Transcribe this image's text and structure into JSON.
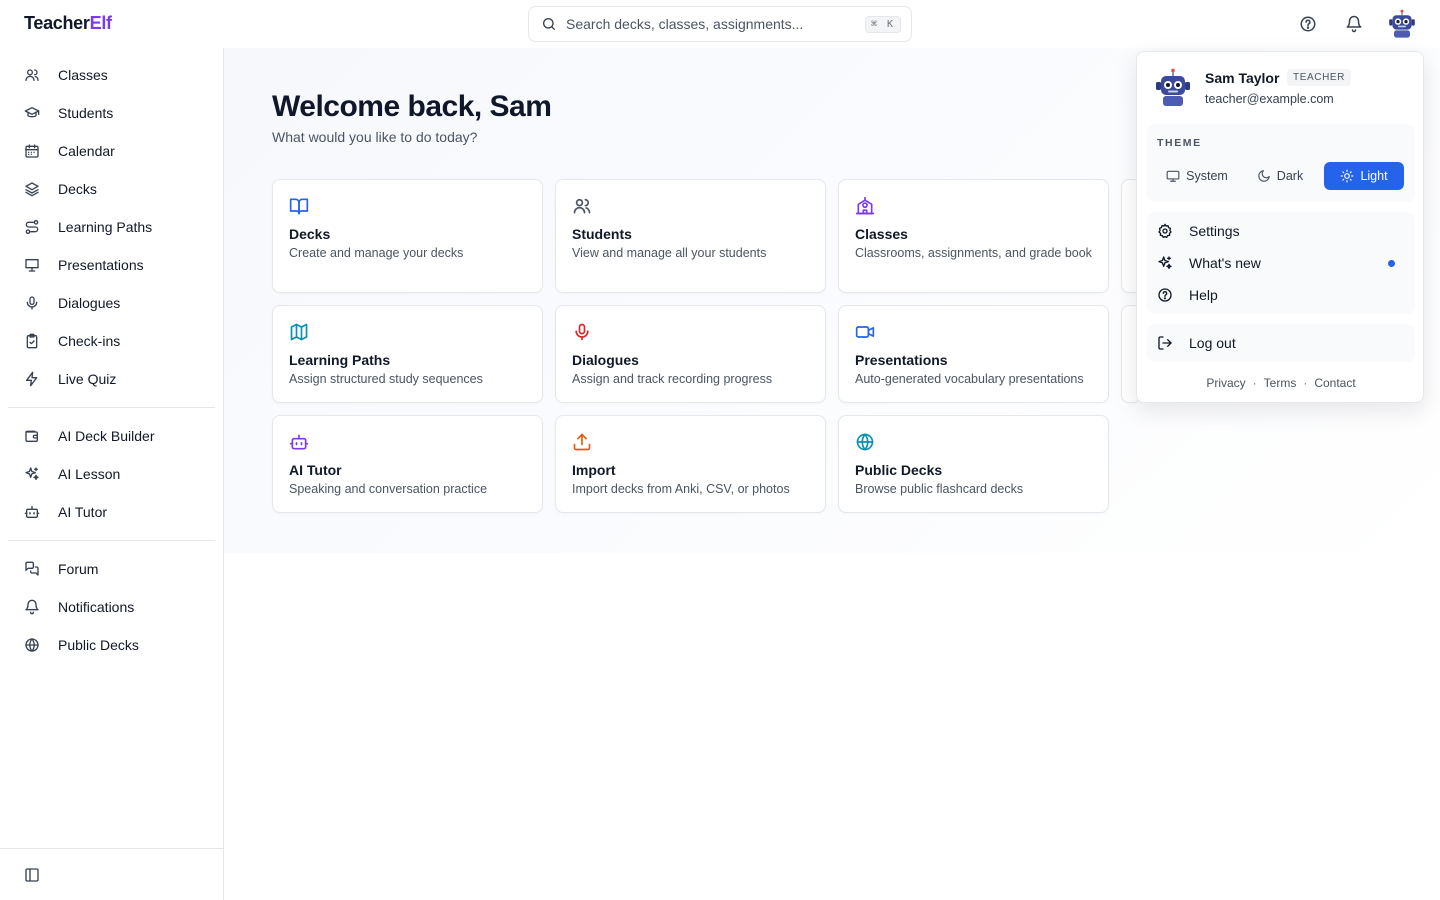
{
  "brand": {
    "name_part1": "Teacher",
    "name_part2": "Elf"
  },
  "search": {
    "placeholder": "Search decks, classes, assignments...",
    "shortcut": "⌘ K"
  },
  "header_icons": [
    "help-circle-icon",
    "bell-icon",
    "robot-avatar-icon"
  ],
  "sidebar": {
    "group1": [
      {
        "label": "Classes",
        "icon": "users-icon"
      },
      {
        "label": "Students",
        "icon": "graduation-cap-icon"
      },
      {
        "label": "Calendar",
        "icon": "calendar-icon"
      },
      {
        "label": "Decks",
        "icon": "layers-icon"
      },
      {
        "label": "Learning Paths",
        "icon": "route-icon"
      },
      {
        "label": "Presentations",
        "icon": "presentation-icon"
      },
      {
        "label": "Dialogues",
        "icon": "mic-icon"
      },
      {
        "label": "Check-ins",
        "icon": "clipboard-check-icon"
      },
      {
        "label": "Live Quiz",
        "icon": "zap-icon"
      }
    ],
    "group2": [
      {
        "label": "AI Deck Builder",
        "icon": "wallet-icon"
      },
      {
        "label": "AI Lesson",
        "icon": "sparkles-icon"
      },
      {
        "label": "AI Tutor",
        "icon": "bot-icon"
      }
    ],
    "group3": [
      {
        "label": "Forum",
        "icon": "messages-icon"
      },
      {
        "label": "Notifications",
        "icon": "bell-icon"
      },
      {
        "label": "Public Decks",
        "icon": "globe-icon"
      }
    ]
  },
  "main": {
    "welcome": "Welcome back, Sam",
    "subtitle": "What would you like to do today?",
    "cards": [
      {
        "title": "Decks",
        "desc": "Create and manage your decks",
        "icon": "book-open-icon",
        "color": "#2563eb"
      },
      {
        "title": "Students",
        "desc": "View and manage all your students",
        "icon": "users-icon",
        "color": "#4b5563"
      },
      {
        "title": "Classes",
        "desc": "Classrooms, assignments, and grade book",
        "icon": "school-icon",
        "color": "#7c3aed"
      },
      {
        "title": "Learning Paths",
        "desc": "Assign structured study sequences",
        "icon": "map-icon",
        "color": "#0891b2"
      },
      {
        "title": "Dialogues",
        "desc": "Assign and track recording progress",
        "icon": "mic-icon",
        "color": "#dc2626"
      },
      {
        "title": "Presentations",
        "desc": "Auto-generated vocabulary presentations",
        "icon": "video-icon",
        "color": "#2563eb"
      },
      {
        "title": "AI Tutor",
        "desc": "Speaking and conversation practice",
        "icon": "bot-icon",
        "color": "#7c3aed"
      },
      {
        "title": "Import",
        "desc": "Import decks from Anki, CSV, or photos",
        "icon": "upload-icon",
        "color": "#ea580c"
      },
      {
        "title": "Public Decks",
        "desc": "Browse public flashcard decks",
        "icon": "globe-icon",
        "color": "#0891b2"
      }
    ]
  },
  "user_menu": {
    "name": "Sam Taylor",
    "role": "TEACHER",
    "email": "teacher@example.com",
    "theme_label": "THEME",
    "themes": [
      {
        "label": "System",
        "icon": "monitor-icon",
        "active": false
      },
      {
        "label": "Dark",
        "icon": "moon-icon",
        "active": false
      },
      {
        "label": "Light",
        "icon": "sun-icon",
        "active": true
      }
    ],
    "actions": [
      {
        "label": "Settings",
        "icon": "gear-icon"
      },
      {
        "label": "What's new",
        "icon": "sparkles-icon",
        "has_unread": true
      },
      {
        "label": "Help",
        "icon": "help-circle-icon"
      }
    ],
    "logout": "Log out",
    "footer": {
      "privacy": "Privacy",
      "terms": "Terms",
      "contact": "Contact",
      "separator": "·"
    }
  },
  "colors": {
    "accent": "#2563eb",
    "brand_purple": "#7c3aed"
  }
}
